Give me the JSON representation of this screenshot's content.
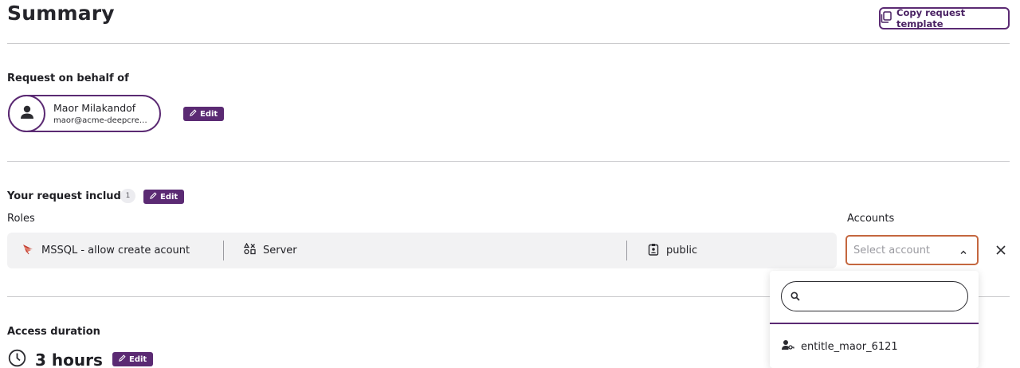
{
  "page": {
    "title": "Summary",
    "copy_template_label": "Copy request template"
  },
  "behalf": {
    "heading": "Request on behalf of",
    "user_name": "Maor Milakandof",
    "user_email": "maor@acme-deepcred...",
    "edit_label": "Edit"
  },
  "includes": {
    "heading": "Your request includes",
    "count": "1",
    "edit_label": "Edit",
    "roles_label": "Roles",
    "accounts_label": "Accounts",
    "role": {
      "name": "MSSQL - allow create acount",
      "type": "Server",
      "scope": "public"
    },
    "account_select_placeholder": "Select account"
  },
  "dropdown": {
    "search_placeholder": "",
    "options": [
      "entitle_maor_6121"
    ]
  },
  "duration": {
    "heading": "Access duration",
    "value": "3 hours",
    "edit_label": "Edit"
  },
  "colors": {
    "accent": "#5b2a73",
    "select_border": "#c4673f",
    "row_bg": "#f2f2f3"
  }
}
